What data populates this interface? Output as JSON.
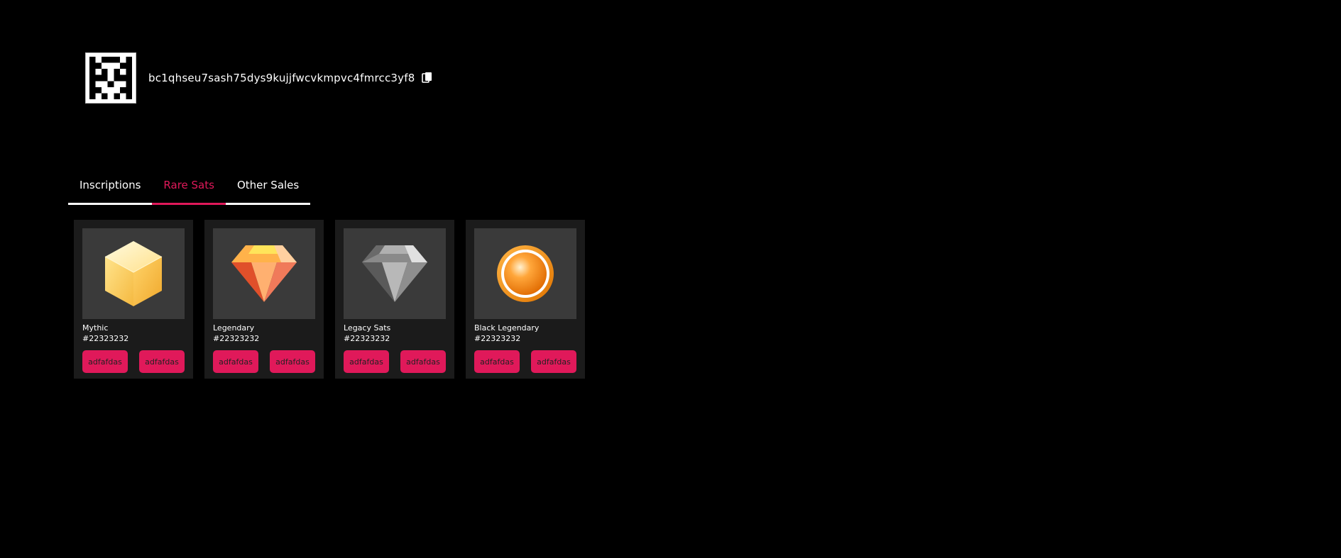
{
  "profile": {
    "address": "bc1qhseu7sash75dys9kujjfwcvkmpvc4fmrcc3yf8",
    "avatar_icon": "pixel-identicon",
    "copy_icon": "copy-icon"
  },
  "tabs": [
    {
      "label": "Inscriptions",
      "active": false
    },
    {
      "label": "Rare Sats",
      "active": true
    },
    {
      "label": "Other Sales",
      "active": false
    }
  ],
  "colors": {
    "accent": "#e0195a",
    "background": "#000000",
    "card": "#1b1b1b"
  },
  "cards": [
    {
      "name": "Mythic",
      "number": "#22323232",
      "icon": "yellow-cube-icon",
      "buttons": [
        "adfafdas",
        "adfafdas"
      ]
    },
    {
      "name": "Legendary",
      "number": "#22323232",
      "icon": "orange-gem-icon",
      "buttons": [
        "adfafdas",
        "adfafdas"
      ]
    },
    {
      "name": "Legacy Sats",
      "number": "#22323232",
      "icon": "gray-gem-icon",
      "buttons": [
        "adfafdas",
        "adfafdas"
      ]
    },
    {
      "name": "Black Legendary",
      "number": "#22323232",
      "icon": "orange-coin-icon",
      "buttons": [
        "adfafdas",
        "adfafdas"
      ]
    }
  ]
}
